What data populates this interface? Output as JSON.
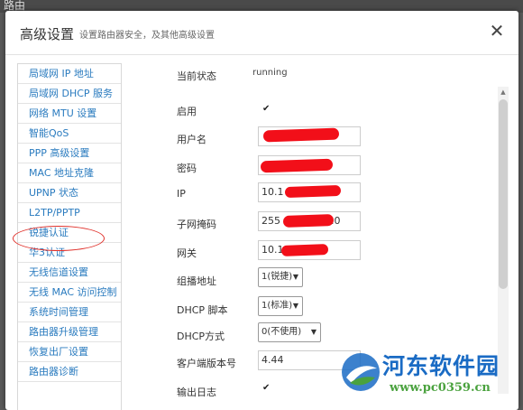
{
  "background_title": "路由",
  "dialog": {
    "title": "高级设置",
    "subtitle": "设置路由器安全，及其他高级设置",
    "close_icon": "close-icon"
  },
  "sidebar": {
    "items": [
      {
        "label": "局域网 IP 地址"
      },
      {
        "label": "局域网 DHCP 服务"
      },
      {
        "label": "网络 MTU 设置"
      },
      {
        "label": "智能QoS"
      },
      {
        "label": "PPP 高级设置"
      },
      {
        "label": "MAC 地址克隆"
      },
      {
        "label": "UPNP 状态"
      },
      {
        "label": "L2TP/PPTP"
      },
      {
        "label": "锐捷认证"
      },
      {
        "label": "华3认证"
      },
      {
        "label": "无线信道设置"
      },
      {
        "label": "无线 MAC 访问控制"
      },
      {
        "label": "系统时间管理"
      },
      {
        "label": "路由器升级管理"
      },
      {
        "label": "恢复出厂设置"
      },
      {
        "label": "路由器诊断"
      }
    ],
    "highlighted_item": "锐捷认证",
    "highlight_color": "#e0302a"
  },
  "form": {
    "status_label": "当前状态",
    "status_value": "running",
    "enable_label": "启用",
    "enable_checked": true,
    "username_label": "用户名",
    "username_value": "",
    "password_label": "密码",
    "password_value": "",
    "ip_label": "IP",
    "ip_value": "10.1",
    "mask_label": "子网掩码",
    "mask_value": "255",
    "mask_value_end": ".0",
    "gateway_label": "网关",
    "gateway_value": "10.1",
    "multicast_label": "组播地址",
    "multicast_value": "1(锐捷)",
    "dhcp_script_label": "DHCP 脚本",
    "dhcp_script_value": "1(标准)",
    "dhcp_mode_label": "DHCP方式",
    "dhcp_mode_value": "0(不使用)",
    "client_version_label": "客户端版本号",
    "client_version_value": "4.44",
    "log_label": "输出日志",
    "log_checked": true
  },
  "watermark": {
    "title": "河东软件园",
    "url": "www.pc0359.cn"
  },
  "colors": {
    "link": "#2a7bbf",
    "redaction": "#f20f19",
    "watermark_blue": "#1a6bc4",
    "watermark_green": "#4aa23e"
  }
}
